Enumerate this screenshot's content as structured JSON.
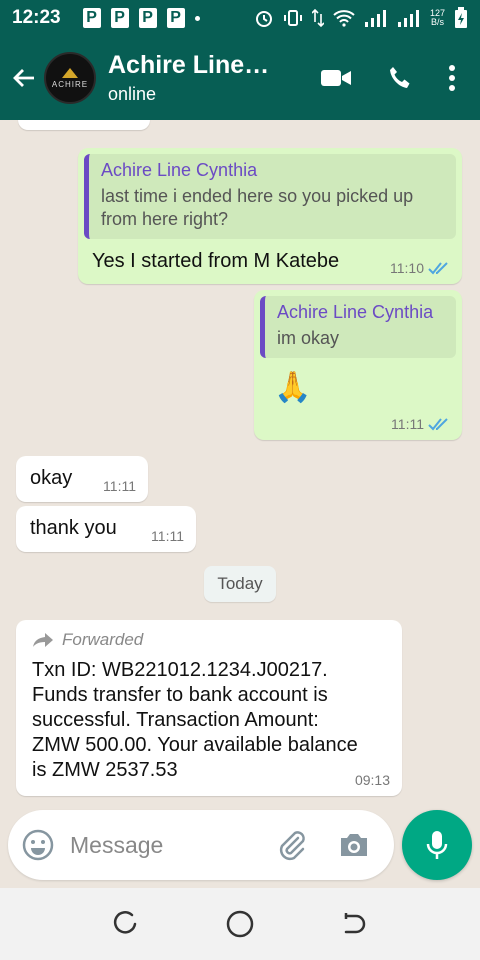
{
  "status_bar": {
    "time": "12:23",
    "notification_badges": [
      "P",
      "P",
      "P",
      "P"
    ],
    "net_speed_value": "127",
    "net_speed_unit": "B/s"
  },
  "header": {
    "contact_name": "Achire Line…",
    "status": "online",
    "avatar_text": "ACHIRE",
    "colors": {
      "header_bg": "#075e54",
      "accent": "#00a884"
    }
  },
  "messages": [
    {
      "direction": "outgoing",
      "quote_author": "Achire Line Cynthia",
      "quote_text": "last time i ended here so you picked up from here right?",
      "text": "Yes I started from M Katebe",
      "time": "11:10",
      "status_icon": "double-check-read-icon"
    },
    {
      "direction": "outgoing",
      "quote_author": "Achire Line Cynthia",
      "quote_text": "im okay",
      "text": "🙏",
      "time": "11:11",
      "status_icon": "double-check-read-icon"
    },
    {
      "direction": "incoming",
      "text": "okay",
      "time": "11:11"
    },
    {
      "direction": "incoming",
      "text": "thank you",
      "time": "11:11"
    }
  ],
  "date_separator": "Today",
  "forwarded_message": {
    "label": "Forwarded",
    "text": "Txn ID: WB221012.1234.J00217. Funds transfer to bank account is successful. Transaction Amount: ZMW 500.00. Your available balance is ZMW 2537.53",
    "time": "09:13"
  },
  "input": {
    "placeholder": "Message"
  }
}
